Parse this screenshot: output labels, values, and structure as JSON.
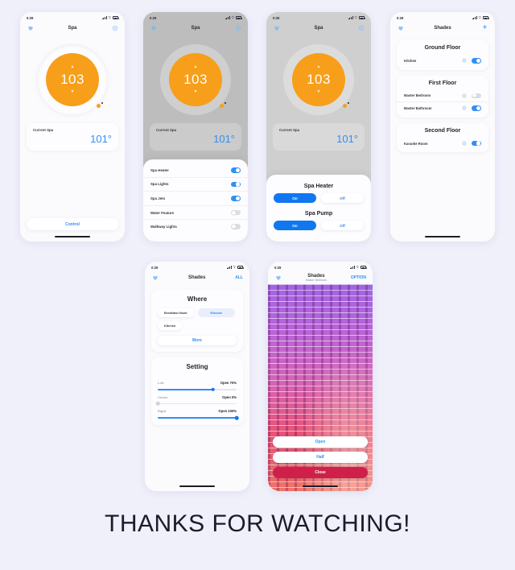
{
  "page": {
    "background": "#f0f0fb",
    "footer": "THANKS FOR WATCHING!"
  },
  "colors": {
    "accent_blue": "#2f8ff5",
    "accent_blue_strong": "#1177f0",
    "orange": "#f79f1a",
    "danger_red": "#ce2048"
  },
  "status_bar": {
    "time": "0:29"
  },
  "screens": [
    {
      "id": "spa-main",
      "nav": {
        "title": "Spa",
        "left_icon": "heart-icon",
        "right_icon": "gear-icon"
      },
      "dial": {
        "value": "103",
        "up_icon": "chevron-up-icon",
        "down_icon": "chevron-down-icon"
      },
      "current": {
        "label": "Current Spa",
        "value": "101°"
      },
      "control_button": "Control"
    },
    {
      "id": "spa-toggles",
      "nav": {
        "title": "Spa",
        "left_icon": "heart-icon",
        "right_icon": "gear-icon"
      },
      "dial": {
        "value": "103"
      },
      "current": {
        "label": "Current Spa",
        "value": "101°"
      },
      "toggles": [
        {
          "label": "Spa Heater",
          "on": true
        },
        {
          "label": "Spa Lights",
          "on": true
        },
        {
          "label": "Spa Jets",
          "on": true
        },
        {
          "label": "Water Feature",
          "on": false
        },
        {
          "label": "Walkway Lights",
          "on": false
        }
      ]
    },
    {
      "id": "spa-onoff",
      "nav": {
        "title": "Spa",
        "left_icon": "heart-icon",
        "right_icon": "gear-icon"
      },
      "dial": {
        "value": "103"
      },
      "current": {
        "label": "Current Spa",
        "value": "101°"
      },
      "groups": [
        {
          "title": "Spa Heater",
          "on_label": "On",
          "off_label": "Off",
          "selected": "On"
        },
        {
          "title": "Spa Pump",
          "on_label": "On",
          "off_label": "Off",
          "selected": "On"
        }
      ]
    },
    {
      "id": "shades-floors",
      "nav": {
        "title": "Shades",
        "left_icon": "heart-icon",
        "right_icon": "plus-icon"
      },
      "floors": [
        {
          "title": "Ground Floor",
          "rooms": [
            {
              "name": "Kitchen",
              "on": true
            }
          ]
        },
        {
          "title": "First Floor",
          "rooms": [
            {
              "name": "Master Bedroom",
              "on": false
            },
            {
              "name": "Master Bathroom",
              "on": true
            }
          ]
        },
        {
          "title": "Second Floor",
          "rooms": [
            {
              "name": "Karaoke Room",
              "on": true
            }
          ]
        }
      ]
    },
    {
      "id": "shades-settings",
      "nav": {
        "title": "Shades",
        "left_icon": "heart-icon",
        "right_label": "ALL"
      },
      "where": {
        "title": "Where",
        "chips": [
          {
            "label": "Breakfast Nook",
            "selected": false
          },
          {
            "label": "Window",
            "selected": true
          },
          {
            "label": "Kitchen",
            "selected": false
          }
        ],
        "more_label": "More"
      },
      "setting": {
        "title": "Setting",
        "sliders": [
          {
            "name": "Left",
            "value_label": "Open 70%",
            "percent": 70
          },
          {
            "name": "Center",
            "value_label": "Open 0%",
            "percent": 0
          },
          {
            "name": "Right",
            "value_label": "Open 100%",
            "percent": 100
          }
        ]
      }
    },
    {
      "id": "shades-detail",
      "nav": {
        "title": "Shades",
        "subtitle": "Master Bedroom",
        "left_icon": "heart-icon",
        "right_label": "OPTION"
      },
      "actions": [
        {
          "label": "Open",
          "style": "light"
        },
        {
          "label": "Half",
          "style": "light"
        },
        {
          "label": "Close",
          "style": "danger"
        }
      ]
    }
  ]
}
